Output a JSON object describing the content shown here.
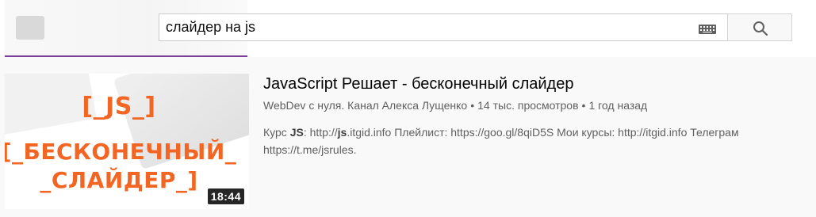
{
  "search": {
    "query": "слайдер на js"
  },
  "result": {
    "title": "JavaScript Решает - бесконечный слайдер",
    "channel": "WebDev с нуля. Канал Алекса Лущенко",
    "separator": "•",
    "views": "14 тыс. просмотров",
    "age": "1 год назад",
    "duration": "18:44",
    "thumbnail": {
      "line1": "[_JS_]",
      "line2": "[_БЕСКОНЕЧНЫЙ_",
      "line3": "_СЛАЙДЕР_]"
    },
    "description": {
      "p1": "Курс ",
      "b1": "JS",
      "p2": ": http://",
      "b2": "js",
      "p3": ".itgid.info Плейлист: https://goo.gl/8qiD5S Мои курсы: http://itgid.info Телеграм",
      "line2": "https://t.me/jsrules."
    }
  },
  "colors": {
    "accent_progress": "#7b3f9b",
    "thumb_text": "#f26522"
  }
}
